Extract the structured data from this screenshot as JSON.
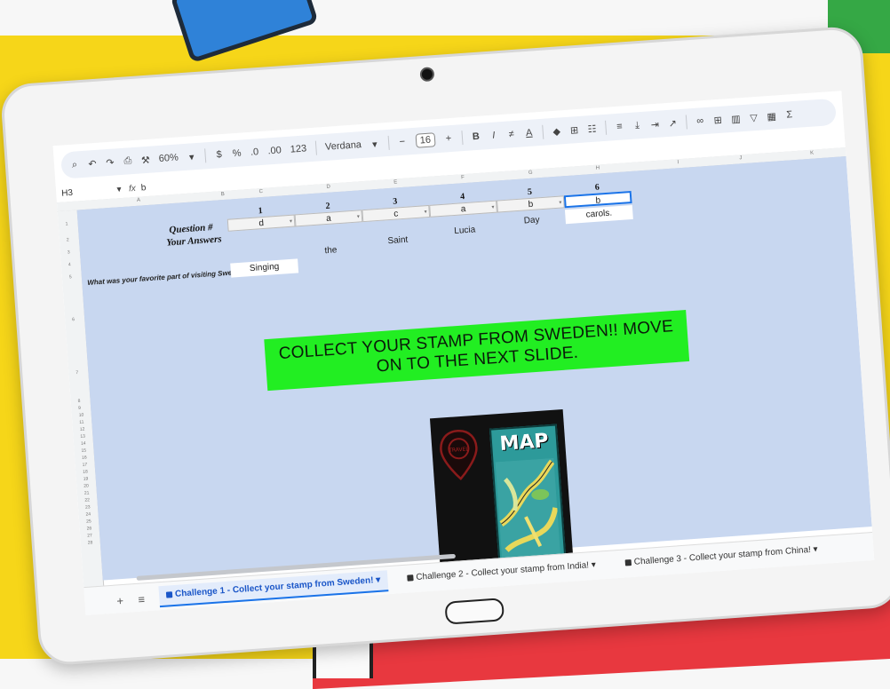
{
  "toolbar": {
    "zoom": "60%",
    "currency": "$",
    "percent": "%",
    "decrease_decimal": ".0",
    "increase_decimal": ".00",
    "number_format": "123",
    "font": "Verdana",
    "font_size": "16",
    "bold": "B",
    "italic": "I",
    "text_color": "A",
    "sum": "Σ"
  },
  "formula_bar": {
    "cell": "H3",
    "fx": "fx",
    "value": "b"
  },
  "columns": [
    "A",
    "B",
    "C",
    "D",
    "E",
    "F",
    "G",
    "H",
    "I",
    "J",
    "K"
  ],
  "rows": [
    "1",
    "2",
    "3",
    "4",
    "5",
    "6",
    "7",
    "8",
    "9",
    "10",
    "11",
    "12",
    "13",
    "14",
    "15",
    "16",
    "17",
    "18",
    "19",
    "20",
    "21",
    "22",
    "23",
    "24",
    "25",
    "26",
    "27",
    "28"
  ],
  "quiz": {
    "question_label": "Question #",
    "answers_label": "Your Answers",
    "question_numbers": [
      "1",
      "2",
      "3",
      "4",
      "5",
      "6"
    ],
    "answers": [
      "d",
      "a",
      "c",
      "a",
      "b",
      "b"
    ],
    "prompt": "What was your favorite part of visiting Sweden?",
    "response_words": [
      "Singing",
      "the",
      "Saint",
      "Lucia",
      "Day",
      "carols."
    ]
  },
  "banner": {
    "line1": "COLLECT YOUR STAMP FROM SWEDEN!! MOVE",
    "line2": "ON TO THE NEXT SLIDE.",
    "color": "#22ee22"
  },
  "image": {
    "title": "MAP",
    "pin_text": "TRAVEL"
  },
  "tabs": [
    "Challenge 1 - Collect your stamp from Sweden!",
    "Challenge 2 - Collect your stamp from India!",
    "Challenge 3 - Collect your stamp from China!"
  ]
}
